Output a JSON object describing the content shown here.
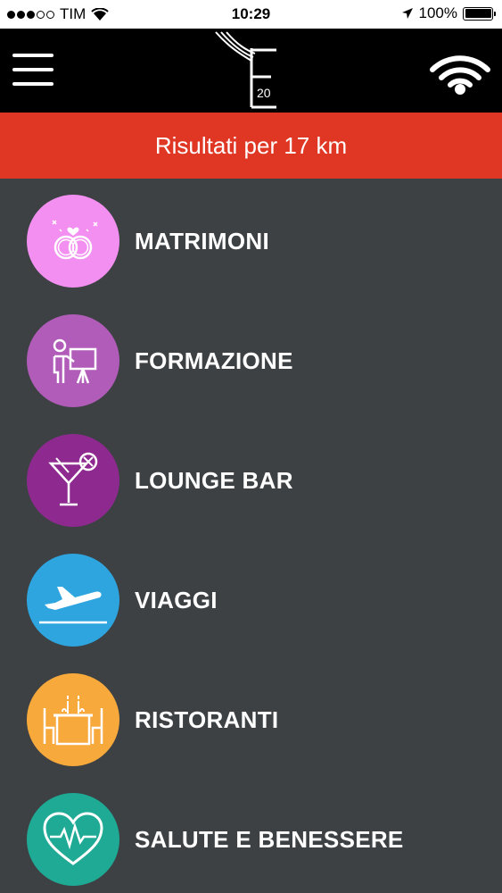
{
  "status_bar": {
    "carrier": "TIM",
    "time": "10:29",
    "battery": "100%",
    "icons": [
      "signal-dots-icon",
      "wifi-icon",
      "location-arrow-icon",
      "battery-icon"
    ]
  },
  "navbar": {
    "menu_icon": "hamburger-menu-icon",
    "logo_text": "20",
    "wifi_icon": "wifi-icon"
  },
  "banner": {
    "text": "Risultati per 17 km",
    "color": "#e03624"
  },
  "categories": [
    {
      "label": "MATRIMONI",
      "icon": "wedding-rings-icon",
      "color": "#f28ff0"
    },
    {
      "label": "FORMAZIONE",
      "icon": "teacher-board-icon",
      "color": "#b05cb8"
    },
    {
      "label": "LOUNGE BAR",
      "icon": "cocktail-icon",
      "color": "#8e2a8f"
    },
    {
      "label": "VIAGGI",
      "icon": "airplane-icon",
      "color": "#2ea5df"
    },
    {
      "label": "RISTORANTI",
      "icon": "dinner-table-icon",
      "color": "#f7a93c"
    },
    {
      "label": "SALUTE E BENESSERE",
      "icon": "heart-pulse-icon",
      "color": "#1faa95"
    }
  ],
  "theme": {
    "background": "#3d4144",
    "navbar": "#000000"
  }
}
